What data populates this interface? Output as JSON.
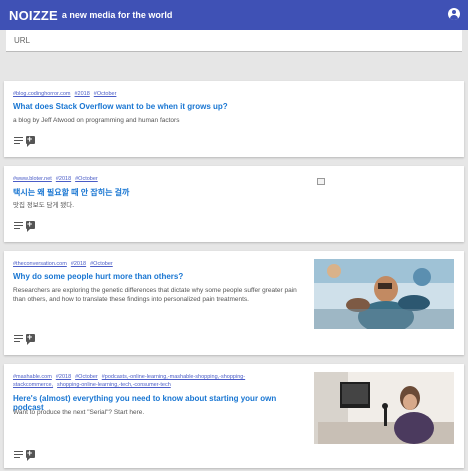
{
  "header": {
    "brand": "NOIZZE",
    "tagline": "a new media for the world",
    "account_icon": "account-circle-icon"
  },
  "url_input": {
    "placeholder": "URL"
  },
  "articles": [
    {
      "tags": [
        "#blog.codinghorror.com",
        "#2018",
        "#October"
      ],
      "title": "What does Stack Overflow want to be when it grows up?",
      "description": "a blog by Jeff Atwood on programming and human factors"
    },
    {
      "tags": [
        "#www.bloter.net",
        "#2018",
        "#October"
      ],
      "title": "택시는 왜 필요할 때 안 잡히는 걸까",
      "description": "맛집 정보도 담게 됐다."
    },
    {
      "tags": [
        "#theconversation.com",
        "#2018",
        "#October"
      ],
      "title": "Why do some people hurt more than others?",
      "description": "Researchers are exploring the genetic differences that dictate why some people suffer greater pain than others, and how to translate these findings into personalized pain treatments."
    },
    {
      "tags": [
        "#mashable.com",
        "#2018",
        "#October",
        "#podcasts,-online-learning,-mashable-shopping,-shopping-stackcommerce,",
        "shopping-online-learning,-tech,-consumer-tech"
      ],
      "title": "Here's (almost) everything you need to know about starting your own podcast",
      "description": "Want to produce the next \"Serial\"? Start here."
    }
  ],
  "icons": {
    "lines": "notes-icon",
    "comment": "add-comment-icon"
  }
}
